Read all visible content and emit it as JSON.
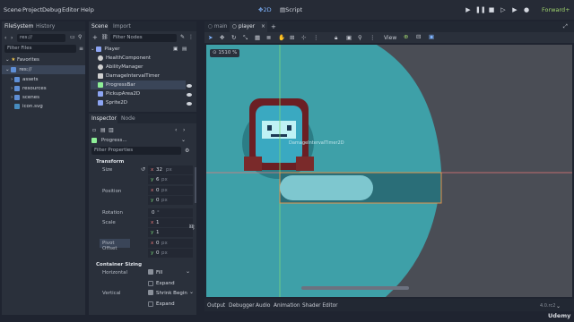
{
  "menubar": {
    "menus": [
      "Scene",
      "Project",
      "Debug",
      "Editor",
      "Help"
    ],
    "workspaces": [
      "2D",
      "Script"
    ],
    "renderer": "Forward+"
  },
  "filesystem": {
    "tabs": [
      "FileSystem",
      "History"
    ],
    "path": "res://",
    "filter_placeholder": "Filter Files",
    "favorites_label": "Favorites",
    "root": "res://",
    "items": [
      "assets",
      "resources",
      "scenes",
      "icon.svg"
    ]
  },
  "scene": {
    "tabs": [
      "Scene",
      "Import"
    ],
    "filter_placeholder": "Filter Nodes",
    "nodes": [
      "Player",
      "HealthComponent",
      "AbilityManager",
      "DamageIntervalTimer",
      "ProgressBar",
      "PickupArea2D",
      "Sprite2D"
    ]
  },
  "inspector": {
    "tabs": [
      "Inspector",
      "Node"
    ],
    "object_name": "Progress...",
    "filter_placeholder": "Filter Properties",
    "section_transform": "Transform",
    "size_label": "Size",
    "size_x": "32",
    "size_unit": "px",
    "size_y": "6",
    "position_label": "Position",
    "position_x": "0",
    "position_y": "0",
    "rotation_label": "Rotation",
    "rotation_value": "0",
    "rotation_unit": "°",
    "scale_label": "Scale",
    "scale_x": "1",
    "scale_y": "1",
    "pivot_label": "Pivot Offset",
    "pivot_x": "0",
    "pivot_y": "0",
    "section_container": "Container Sizing",
    "horizontal_label": "Horizontal",
    "horizontal_value": "Fill",
    "expand_label": "Expand",
    "vertical_label": "Vertical",
    "vertical_value": "Shrink Begin",
    "expand2_label": "Expand"
  },
  "editor": {
    "tabs": [
      "main",
      "player"
    ],
    "zoom": "1510 %",
    "view_label": "View",
    "canvas_label": "DamageIntervalTimer2D"
  },
  "bottom_tabs": [
    "Output",
    "Debugger",
    "Audio",
    "Animation",
    "Shader Editor"
  ],
  "version": "4.0.rc2",
  "watermark": "Udemy",
  "colors": {
    "accent": "#569eff",
    "bg_panel": "#2a303b",
    "canvas_bg": "#4a4d55",
    "teal": "#3ea0a8",
    "axis_x": "#e8787a",
    "axis_y": "#7ad67a",
    "selection": "#e3944b"
  }
}
